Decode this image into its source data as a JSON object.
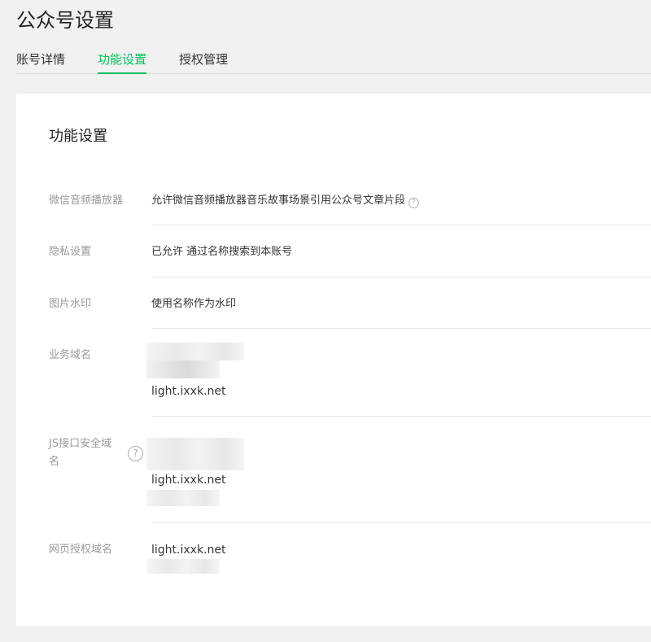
{
  "page": {
    "title": "公众号设置"
  },
  "tabs": [
    {
      "label": "账号详情",
      "active": false
    },
    {
      "label": "功能设置",
      "active": true
    },
    {
      "label": "授权管理",
      "active": false
    }
  ],
  "card": {
    "title": "功能设置",
    "rows": {
      "audio_player": {
        "label": "微信音频播放器",
        "value": "允许微信音频播放器音乐故事场景引用公众号文章片段"
      },
      "privacy": {
        "label": "隐私设置",
        "value": "已允许 通过名称搜索到本账号"
      },
      "watermark": {
        "label": "图片水印",
        "value": "使用名称作为水印"
      },
      "business_domain": {
        "label": "业务域名",
        "domain": "light.ixxk.net"
      },
      "js_domain": {
        "label": "JS接口安全域名",
        "domain": "light.ixxk.net"
      },
      "auth_domain": {
        "label": "网页授权域名",
        "domain": "light.ixxk.net"
      }
    }
  },
  "icons": {
    "help": "?"
  },
  "colors": {
    "accent": "#07c160",
    "label": "#9a9a9a",
    "text": "#353535",
    "background": "#f1f1f1",
    "card": "#ffffff"
  }
}
